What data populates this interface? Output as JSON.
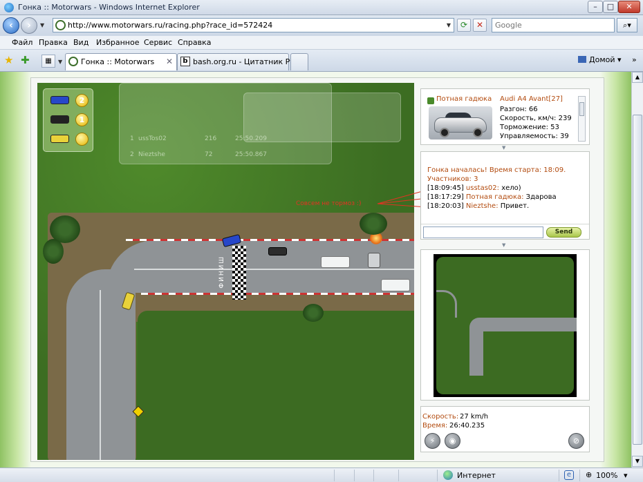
{
  "window": {
    "title": "Гонка :: Motorwars - Windows Internet Explorer",
    "minimize": "–",
    "maximize": "□",
    "close": "✕"
  },
  "address": {
    "url": "http://www.motorwars.ru/racing.php?race_id=572424",
    "search_placeholder": "Google",
    "search_button": "⌕▾"
  },
  "menu": [
    "Файл",
    "Правка",
    "Вид",
    "Избранное",
    "Сервис",
    "Справка"
  ],
  "tabs": [
    {
      "label": "Гонка :: Motorwars",
      "close": "✕"
    },
    {
      "label": "bash.org.ru - Цитатник Рун...",
      "icon_letter": "b"
    }
  ],
  "toolbar": {
    "home_label": "Домой",
    "home_arrow": "▾",
    "overflow": "»"
  },
  "game": {
    "legend": [
      {
        "color": "#2747c9",
        "position": "2"
      },
      {
        "color": "#222222",
        "position": "1"
      },
      {
        "color": "#e9d23a",
        "position": ""
      }
    ],
    "standings": [
      {
        "rank": "1",
        "name": "ussTos02",
        "points": "216",
        "time": "25:50.209"
      },
      {
        "rank": "2",
        "name": "Nieztshe",
        "points": "72",
        "time": "25:50.867"
      }
    ],
    "annotation": "Совсем не тормоз :)",
    "road_sign": "ФИНИШ"
  },
  "car_info": {
    "player_name": "Потная гадюка",
    "car_model": "Audi A4 Avant[27]",
    "specs": [
      "Разгон: 66",
      "Скорость, км/ч: 239",
      "Торможение: 53",
      "Управляемость: 39"
    ]
  },
  "chat": {
    "system_lines": [
      "Гонка началась! Время старта: 18:09.",
      "Участников: 3"
    ],
    "messages": [
      {
        "time": "[18:09:45]",
        "nick": "usstas02:",
        "text": " хело)"
      },
      {
        "time": "[18:17:29]",
        "nick": "Потная гадюка:",
        "text": " Здарова"
      },
      {
        "time": "[18:20:03]",
        "nick": "Nieztshe:",
        "text": " Привет."
      }
    ],
    "input_value": "",
    "send_label": "Send"
  },
  "stats": {
    "speed_label": "Скорость:",
    "speed_value": "27 km/h",
    "time_label": "Время:",
    "time_value": "26:40.235"
  },
  "statusbar": {
    "zone": "Интернет",
    "zoom": "100%",
    "zoom_arrow": "▾"
  },
  "colors": {
    "accent_text": "#b24b0f",
    "annotation": "#e23323",
    "grass": "#3c6b22",
    "road": "#8f9396"
  }
}
